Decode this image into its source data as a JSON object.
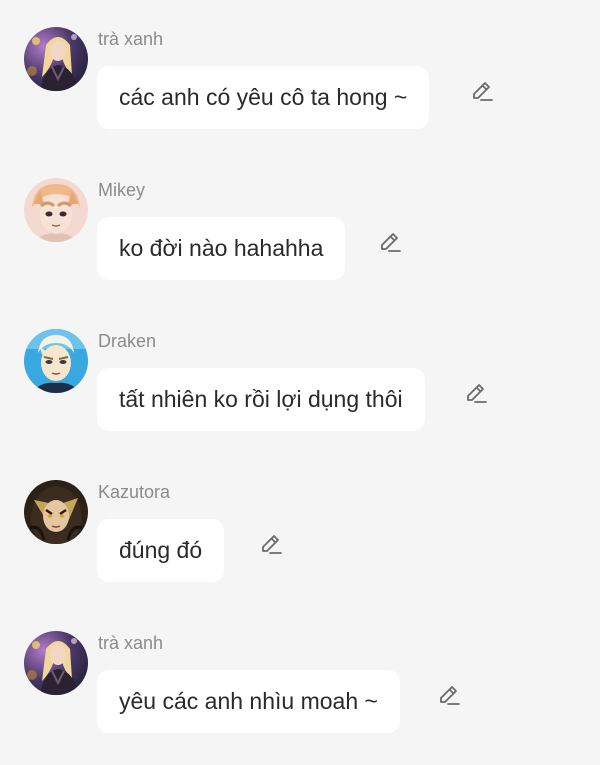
{
  "messages": [
    {
      "sender": "trà xanh",
      "text": "các anh có yêu cô ta hong ~",
      "avatar_icon": "blonde-woman-avatar-icon",
      "edit_icon": "pencil-edit-icon"
    },
    {
      "sender": "Mikey",
      "text": "ko đời nào hahahha",
      "avatar_icon": "mikey-avatar-icon",
      "edit_icon": "pencil-edit-icon"
    },
    {
      "sender": "Draken",
      "text": "tất nhiên ko rồi lợi dụng thôi",
      "avatar_icon": "draken-avatar-icon",
      "edit_icon": "pencil-edit-icon"
    },
    {
      "sender": "Kazutora",
      "text": "đúng đó",
      "avatar_icon": "kazutora-avatar-icon",
      "edit_icon": "pencil-edit-icon"
    },
    {
      "sender": "trà xanh",
      "text": "yêu các anh nhìu moah ~",
      "avatar_icon": "blonde-woman-avatar-icon",
      "edit_icon": "pencil-edit-icon"
    }
  ],
  "colors": {
    "background": "#f5f5f5",
    "bubble": "#ffffff",
    "sender_text": "#8b8b8b",
    "message_text": "#2a2a2a",
    "edit_icon": "#6b6b6b"
  }
}
